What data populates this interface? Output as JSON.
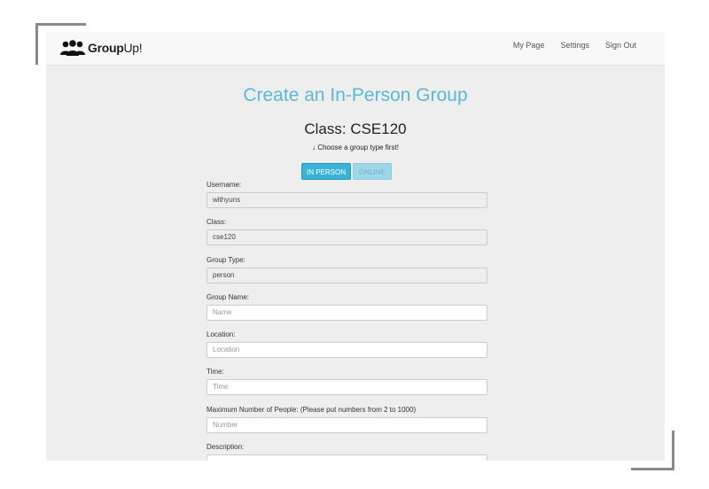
{
  "brand": {
    "name_bold": "Group",
    "name_rest": "Up!"
  },
  "nav": {
    "items": [
      "My Page",
      "Settings",
      "Sign Out"
    ]
  },
  "page": {
    "title": "Create an In-Person Group",
    "class_heading": "Class: CSE120",
    "hint_arrow": "↓",
    "hint_text": "Choose a group type first!"
  },
  "group_type_buttons": {
    "in_person": "IN PERSON",
    "online": "ONLINE"
  },
  "form": {
    "username": {
      "label": "Username:",
      "value": "withyuns"
    },
    "class": {
      "label": "Class:",
      "value": "cse120"
    },
    "group_type": {
      "label": "Group Type:",
      "value": "person"
    },
    "group_name": {
      "label": "Group Name:",
      "placeholder": "Name"
    },
    "location": {
      "label": "Location:",
      "placeholder": "Location"
    },
    "time": {
      "label": "Time:",
      "placeholder": "Time"
    },
    "max_people": {
      "label": "Maximum Number of People: (Please put numbers from 2 to 1000)",
      "placeholder": "Number"
    },
    "description": {
      "label": "Description:"
    }
  },
  "colors": {
    "accent": "#5bb8d6",
    "button": "#39b3d7",
    "background": "#eeeeee",
    "navbar": "#f8f8f8"
  }
}
